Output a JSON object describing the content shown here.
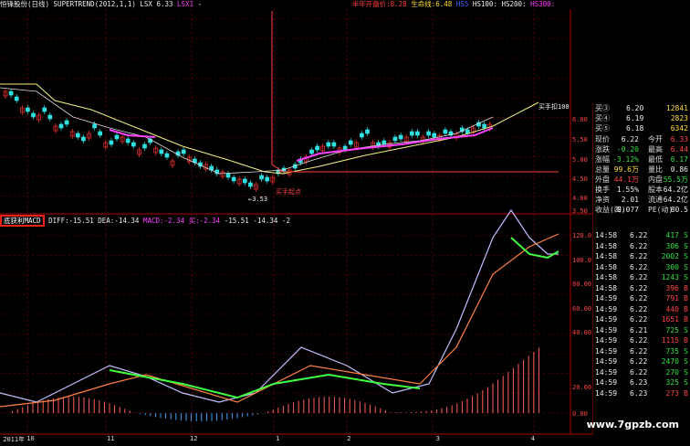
{
  "header": {
    "stock_name": "恒锋股份(日线)",
    "indicator": "SUPERTREND(2012,1,1)",
    "lsx_label": "LSX",
    "lsx_value": "6.33",
    "lsx1_label": "LSX1",
    "lsx1_value": "-",
    "half_year_label": "半年开盘价:",
    "half_year_value": "8.28",
    "lifeline_label": "生命线:",
    "lifeline_value": "6.48",
    "hs50_label": "HS5",
    "hs100_label": "HS100:",
    "hs200_label": "HS200:",
    "hs300_label": "HS300:"
  },
  "price_axis": [
    "6.00",
    "5.50",
    "5.00",
    "4.50",
    "4.00",
    "3.50"
  ],
  "macd_axis": [
    "120.0",
    "100.0",
    "80.00",
    "60.00",
    "40.00",
    "20.00",
    "0.00"
  ],
  "chart_annotations": {
    "low_label": "←3.53",
    "buy_point_label": "买手起点",
    "buy_label_top": "买手扣100"
  },
  "macd_header": {
    "box_label": "底获利MACD",
    "diff_label": "DIFF:",
    "diff_value": "-15.51",
    "dea_label": "DEA:",
    "dea_value": "-14.34",
    "macd_label": "MACD:",
    "macd_value": "-2.34",
    "k_label": "买:",
    "k_value": "-2.34",
    "extra1": "-15.51",
    "extra2": "-14.34",
    "extra3": "-2"
  },
  "date_axis": [
    {
      "label": "2011年",
      "pos": 0.005
    },
    {
      "label": "10",
      "pos": 0.045
    },
    {
      "label": "11",
      "pos": 0.18
    },
    {
      "label": "12",
      "pos": 0.32
    },
    {
      "label": "1",
      "pos": 0.465
    },
    {
      "label": "2",
      "pos": 0.585
    },
    {
      "label": "3",
      "pos": 0.735
    },
    {
      "label": "4",
      "pos": 0.895
    }
  ],
  "order_book": [
    {
      "label": "买③",
      "price": "6.20",
      "vol": "12841"
    },
    {
      "label": "买④",
      "price": "6.19",
      "vol": "2823"
    },
    {
      "label": "买⑤",
      "price": "6.18",
      "vol": "6342"
    }
  ],
  "quote_stats": [
    {
      "l1": "现价",
      "v1": "6.22",
      "l2": "今开",
      "v2": "6.33"
    },
    {
      "l1": "涨跌",
      "v1": "-0.20",
      "l2": "最高",
      "v2": "6.44"
    },
    {
      "l1": "涨幅",
      "v1": "-3.12%",
      "l2": "最低",
      "v2": "6.17"
    },
    {
      "l1": "总量",
      "v1": "99.6万",
      "l2": "量比",
      "v2": "0.86"
    },
    {
      "l1": "外盘",
      "v1": "44.1万",
      "l2": "内盘",
      "v2": "55.5万"
    },
    {
      "l1": "换手",
      "v1": "1.55%",
      "l2": "股本",
      "v2": "64.2亿"
    },
    {
      "l1": "净资",
      "v1": "2.01",
      "l2": "流通",
      "v2": "64.2亿"
    },
    {
      "l1": "收益(四)",
      "v1": "0.077",
      "l2": "PE(动)",
      "v2": "80.5"
    }
  ],
  "ticks": [
    {
      "time": "14:58",
      "price": "6.22",
      "vol": "417",
      "side": "S"
    },
    {
      "time": "14:58",
      "price": "6.22",
      "vol": "306",
      "side": "S"
    },
    {
      "time": "14:58",
      "price": "6.22",
      "vol": "2002",
      "side": "S"
    },
    {
      "time": "14:58",
      "price": "6.22",
      "vol": "300",
      "side": "S"
    },
    {
      "time": "14:58",
      "price": "6.22",
      "vol": "1243",
      "side": "S"
    },
    {
      "time": "14:58",
      "price": "6.22",
      "vol": "396",
      "side": "B"
    },
    {
      "time": "14:59",
      "price": "6.22",
      "vol": "791",
      "side": "B"
    },
    {
      "time": "14:59",
      "price": "6.22",
      "vol": "440",
      "side": "B"
    },
    {
      "time": "14:59",
      "price": "6.22",
      "vol": "1651",
      "side": "B"
    },
    {
      "time": "14:59",
      "price": "6.21",
      "vol": "725",
      "side": "S"
    },
    {
      "time": "14:59",
      "price": "6.22",
      "vol": "1115",
      "side": "B"
    },
    {
      "time": "14:59",
      "price": "6.22",
      "vol": "735",
      "side": "S"
    },
    {
      "time": "14:59",
      "price": "6.22",
      "vol": "2470",
      "side": "S"
    },
    {
      "time": "14:59",
      "price": "6.22",
      "vol": "270",
      "side": "S"
    },
    {
      "time": "14:59",
      "price": "6.23",
      "vol": "325",
      "side": "S"
    },
    {
      "time": "14:59",
      "price": "6.23",
      "vol": "273",
      "side": "B"
    }
  ],
  "watermark": "www.7gpzb.com",
  "colors": {
    "up": "#ff3333",
    "down": "#30e0e0",
    "ma_white": "#dddddd",
    "ma_yellow": "#f0f080",
    "supertrend_pink": "#ff40ff",
    "diff": "#c0c0ff",
    "dea": "#ff8040",
    "macd_green": "#40ff40",
    "grid": "#8b0000"
  }
}
